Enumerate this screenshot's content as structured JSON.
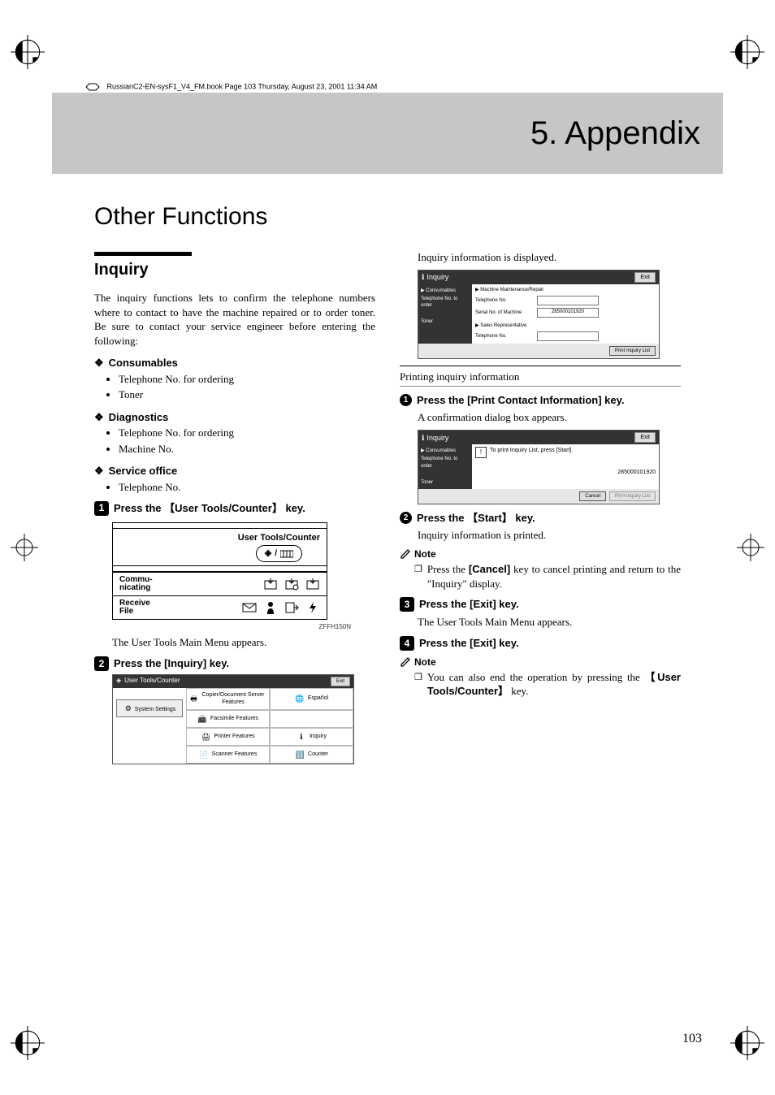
{
  "meta": {
    "header_line": "RussianC2-EN-sysF1_V4_FM.book  Page 103  Thursday, August 23, 2001  11:34 AM",
    "page_number": "103"
  },
  "chapter": {
    "title": "5. Appendix"
  },
  "section": {
    "title": "Other Functions",
    "inquiry_heading": "Inquiry",
    "inquiry_intro": "The inquiry functions lets to confirm the telephone numbers where to contact to have the machine repaired or to order toner. Be sure to contact your service engineer before entering the following:",
    "consumables": {
      "heading": "Consumables",
      "items": [
        "Telephone No. for ordering",
        "Toner"
      ]
    },
    "diagnostics": {
      "heading": "Diagnostics",
      "items": [
        "Telephone No. for ordering",
        "Machine No."
      ]
    },
    "service_office": {
      "heading": "Service office",
      "items": [
        "Telephone No."
      ]
    },
    "step1_text_a": "Press the ",
    "step1_key": "User Tools/Counter",
    "step1_text_b": " key.",
    "figure_panel": {
      "user_tools_label": "User Tools/Counter",
      "communicating": "Commu-\nnicating",
      "receive_file": "Receive\nFile",
      "code": "ZFFH150N"
    },
    "step1_followup": "The User Tools Main Menu ap­pears.",
    "step2_text": "Press the ",
    "step2_key": "[Inquiry]",
    "step2_text_end": " key.",
    "menu_shot": {
      "title": "User Tools/Counter",
      "exit": "Exit",
      "side_button": "System Settings",
      "cells": [
        "Copier/Document Server Features",
        "Español",
        "Facsimile Features",
        "",
        "Printer Features",
        "Inquiry",
        "Scanner Features",
        "Counter"
      ]
    },
    "right_intro": "Inquiry information is displayed.",
    "inquiry_shot": {
      "title": "Inquiry",
      "exit": "Exit",
      "side_heading": "▶ Consumables",
      "side_items": [
        "Telephone No. to order",
        "Toner"
      ],
      "main_heading": "▶ Machine Maintenance/Repair",
      "rows": [
        {
          "label": "Telephone No.",
          "value": ""
        },
        {
          "label": "Serial No. of Machine",
          "value": "285000101920"
        }
      ],
      "sales_heading": "▶ Sales Representative",
      "sales_rows": [
        {
          "label": "Telephone No.",
          "value": ""
        }
      ],
      "print_btn": "Print Inquiry List"
    },
    "printing_heading": "Printing inquiry information",
    "sub1_a": "Press the ",
    "sub1_key": "[Print Contact Informa­tion]",
    "sub1_b": " key.",
    "sub1_followup": "A confirmation dialog box ap­pears.",
    "print_shot": {
      "title": "Inquiry",
      "exit": "Exit",
      "side_heading": "▶ Consumables",
      "side_items": [
        "Telephone No. to order",
        "Toner"
      ],
      "msg": "To print Inquiry List, press [Start].",
      "serial": "285000101920",
      "cancel": "Cancel",
      "print": "Print Inquiry List"
    },
    "sub2_a": "Press the ",
    "sub2_key": "Start",
    "sub2_b": " key.",
    "sub2_followup": "Inquiry information is printed.",
    "note_heading": "Note",
    "note1_a": "Press the ",
    "note1_key": "[Cancel]",
    "note1_b": " key to can­cel printing and return to the \"Inquiry\" display.",
    "step3_a": "Press the ",
    "step3_key": "[Exit]",
    "step3_b": " key.",
    "step3_followup": "The User Tools Main Menu ap­pears.",
    "step4_a": "Press the ",
    "step4_key": "[Exit]",
    "step4_b": " key.",
    "note2_a": "You can also end the operation by pressing the ",
    "note2_key": "User Tools/Counter",
    "note2_b": " key."
  }
}
